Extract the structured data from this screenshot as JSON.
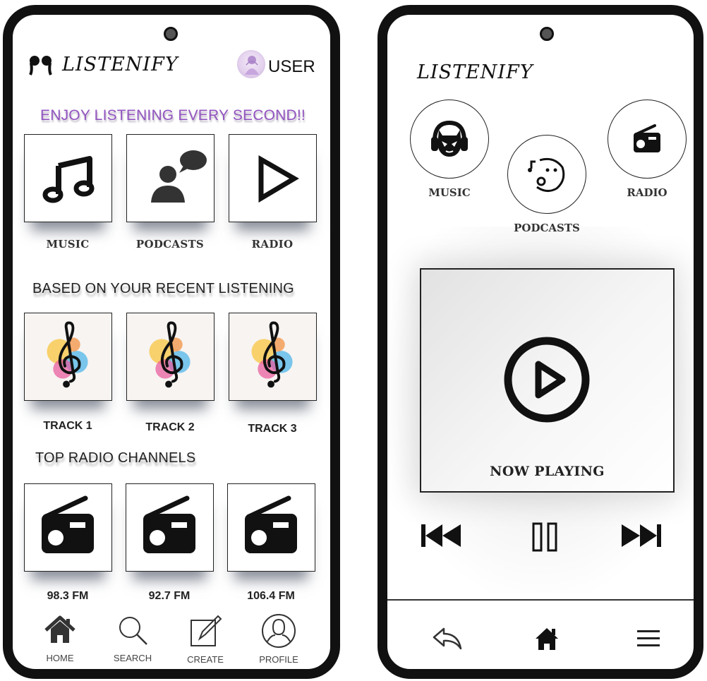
{
  "left_phone": {
    "app_name": "LISTENIFY",
    "user_label": "USER",
    "heading": "ENJOY LISTENING EVERY SECOND!!",
    "categories": [
      {
        "label": "MUSIC",
        "icon": "music-note-icon"
      },
      {
        "label": "PODCASTS",
        "icon": "podcast-speaker-icon"
      },
      {
        "label": "RADIO",
        "icon": "play-triangle-icon"
      }
    ],
    "recent_title": "BASED ON YOUR RECENT LISTENING",
    "tracks": [
      {
        "label": "TRACK 1"
      },
      {
        "label": "TRACK 2"
      },
      {
        "label": "TRACK 3"
      }
    ],
    "radio_title": "TOP RADIO CHANNELS",
    "stations": [
      {
        "label": "98.3 FM"
      },
      {
        "label": "92.7 FM"
      },
      {
        "label": "106.4 FM"
      }
    ],
    "nav": [
      {
        "label": "HOME",
        "icon": "home-icon"
      },
      {
        "label": "SEARCH",
        "icon": "search-icon"
      },
      {
        "label": "CREATE",
        "icon": "edit-icon"
      },
      {
        "label": "PROFILE",
        "icon": "profile-icon"
      }
    ]
  },
  "right_phone": {
    "app_name": "LISTENIFY",
    "categories": [
      {
        "label": "MUSIC",
        "icon": "headphone-cat-icon"
      },
      {
        "label": "PODCASTS",
        "icon": "singing-face-icon"
      },
      {
        "label": "RADIO",
        "icon": "radio-icon"
      }
    ],
    "now_playing_label": "NOW PLAYING",
    "controls": [
      "previous-icon",
      "pause-icon",
      "next-icon"
    ],
    "bottom_nav": [
      "back-icon",
      "home-icon",
      "menu-icon"
    ]
  },
  "colors": {
    "frame": "#111111",
    "heading_purple": "#9254c0",
    "text": "#222222"
  }
}
